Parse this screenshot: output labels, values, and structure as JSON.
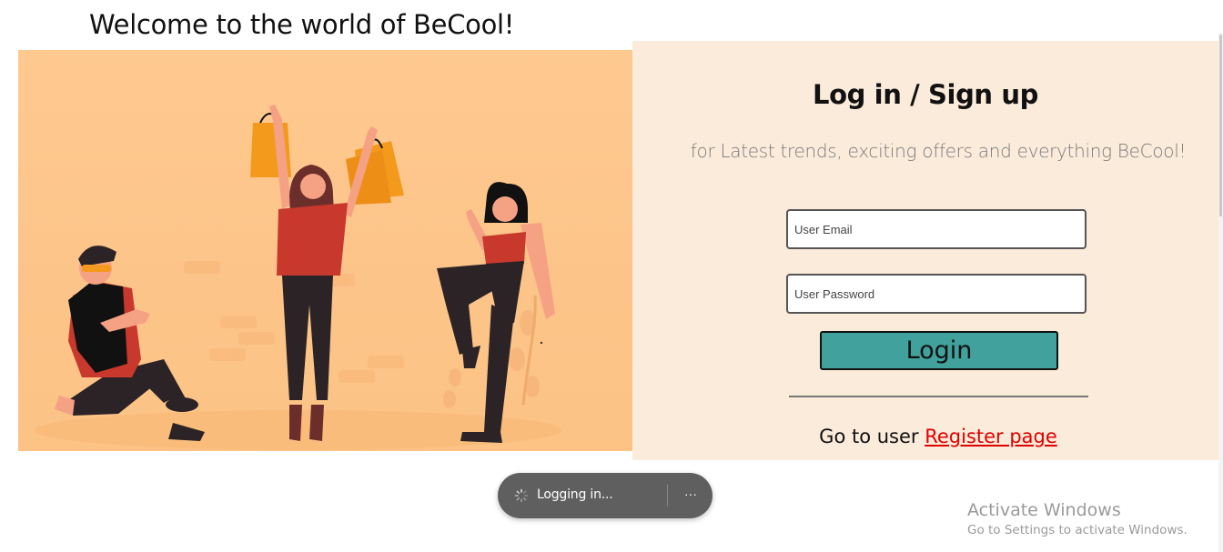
{
  "header": {
    "welcome": "Welcome to the world of BeCool!"
  },
  "login_panel": {
    "title": "Log in / Sign up",
    "subtitle": "for Latest trends, exciting offers and everything BeCool!",
    "email_placeholder": "User Email",
    "email_value": "",
    "password_placeholder": "User Password",
    "password_value": "",
    "login_label": "Login",
    "register_prefix": "Go to user",
    "register_link": "Register page"
  },
  "toast": {
    "text": "Logging in...",
    "more": "···"
  },
  "watermark": {
    "title": "Activate Windows",
    "subtitle": "Go to Settings to activate Windows."
  },
  "colors": {
    "panel_bg": "#fbebda",
    "hero_bg": "#fdc489",
    "button": "#41a19c",
    "link": "#e00000",
    "toast_bg": "#5f5f5f"
  },
  "icons": {
    "spinner": "loading-spinner-icon",
    "more": "more-horizontal-icon"
  }
}
